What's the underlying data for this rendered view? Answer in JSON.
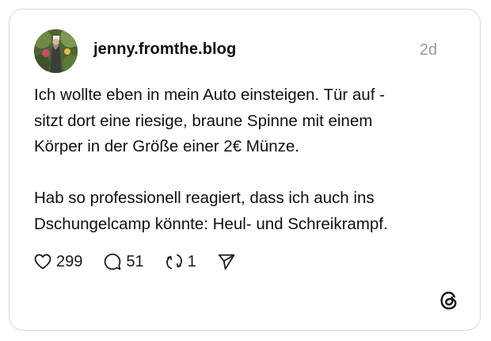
{
  "post": {
    "username": "jenny.fromthe.blog",
    "timestamp": "2d",
    "lines": [
      "Ich wollte eben in mein Auto einsteigen. Tür auf -",
      "sitzt dort eine riesige, braune Spinne mit einem",
      "Körper in der Größe einer 2€ Münze.",
      "",
      "Hab so professionell reagiert, dass ich auch ins",
      "Dschungelcamp könnte: Heul- und Schreikrampf."
    ]
  },
  "actions": {
    "likes": "299",
    "replies": "51",
    "reposts": "1"
  },
  "icons": {
    "like": "heart-icon",
    "reply": "comment-icon",
    "repost": "repost-icon",
    "share": "send-icon",
    "brand": "threads-logo-icon"
  }
}
